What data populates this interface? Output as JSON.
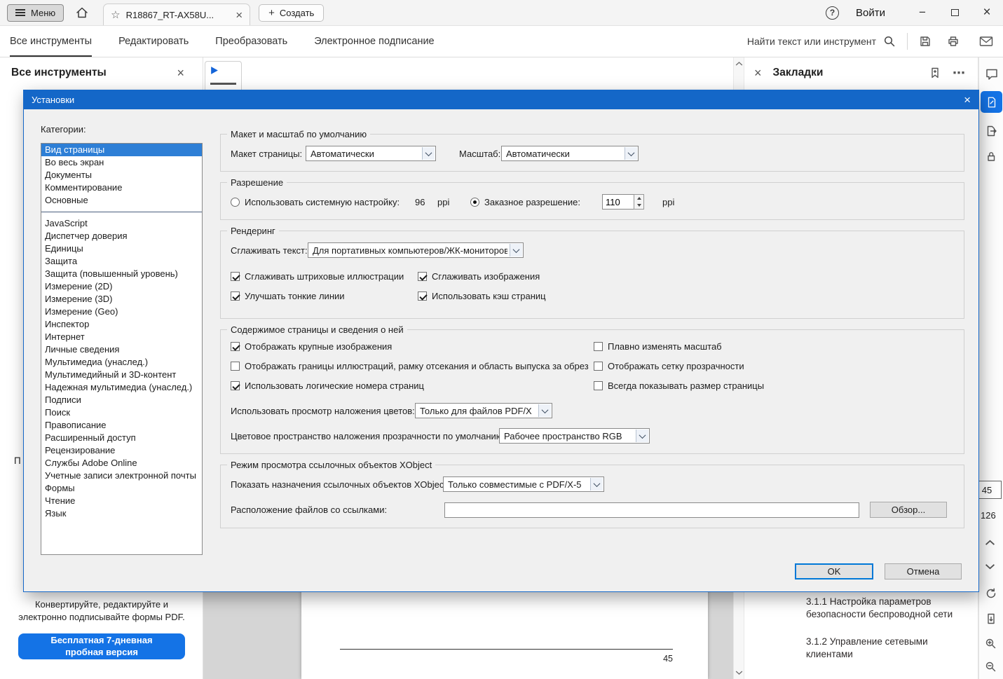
{
  "colors": {
    "accent_blue": "#1473e6",
    "titlebar_blue": "#1467c8",
    "selection_blue": "#2e7fd6",
    "ok_border": "#0078d7"
  },
  "icons": {
    "star": "☆",
    "close": "×",
    "plus": "+",
    "minus": "−",
    "overflow": "⋯",
    "help": "?"
  },
  "window": {
    "menu_label": "Меню",
    "tab_title": "R18867_RT-AX58U...",
    "create_label": "Создать",
    "signin_label": "Войти"
  },
  "toolbar": {
    "tabs": [
      "Все инструменты",
      "Редактировать",
      "Преобразовать",
      "Электронное подписание"
    ],
    "search_label": "Найти текст или инструмент"
  },
  "tools_panel": {
    "title": "Все инструменты",
    "partial_text": "П",
    "promo": "Конвертируйте, редактируйте и электронно подписывайте формы PDF.",
    "trial_line1": "Бесплатная 7-дневная",
    "trial_line2": "пробная версия"
  },
  "bookmarks": {
    "title": "Закладки",
    "items": [
      "3.1.1 Настройка параметров безопасности беспроводной сети",
      "3.1.2 Управление сетевыми клиентами"
    ]
  },
  "page_nav": {
    "current": "45",
    "total": "126"
  },
  "document": {
    "page_label": "45"
  },
  "dialog": {
    "title": "Установки",
    "categories_label": "Категории:",
    "categories_main": [
      "Вид страницы",
      "Во весь экран",
      "Документы",
      "Комментирование",
      "Основные"
    ],
    "categories_rest": [
      "JavaScript",
      "Диспетчер доверия",
      "Единицы",
      "Защита",
      "Защита (повышенный уровень)",
      "Измерение (2D)",
      "Измерение (3D)",
      "Измерение (Geo)",
      "Инспектор",
      "Интернет",
      "Личные сведения",
      "Мультимедиа (унаслед.)",
      "Мультимедийный и 3D-контент",
      "Надежная мультимедиа (унаслед.)",
      "Подписи",
      "Поиск",
      "Правописание",
      "Расширенный доступ",
      "Рецензирование",
      "Службы Adobe Online",
      "Учетные записи электронной почты",
      "Формы",
      "Чтение",
      "Язык"
    ],
    "layout_group": {
      "title": "Макет и масштаб по умолчанию",
      "page_layout_label": "Макет страницы:",
      "page_layout_value": "Автоматически",
      "zoom_label": "Масштаб:",
      "zoom_value": "Автоматически"
    },
    "resolution_group": {
      "title": "Разрешение",
      "system_label": "Использовать системную настройку:",
      "system_checked": false,
      "system_value": "96",
      "ppi": "ppi",
      "custom_label": "Заказное разрешение:",
      "custom_checked": true,
      "custom_value": "110"
    },
    "rendering_group": {
      "title": "Рендеринг",
      "smooth_text_label": "Сглаживать текст:",
      "smooth_text_value": "Для портативных компьютеров/ЖК-мониторов",
      "checks": [
        {
          "label": "Сглаживать штриховые иллюстрации",
          "checked": true
        },
        {
          "label": "Сглаживать изображения",
          "checked": true
        },
        {
          "label": "Улучшать тонкие линии",
          "checked": true
        },
        {
          "label": "Использовать кэш страниц",
          "checked": true
        }
      ]
    },
    "content_group": {
      "title": "Содержимое страницы и сведения о ней",
      "checks_left": [
        {
          "label": "Отображать крупные изображения",
          "checked": true
        },
        {
          "label": "Отображать границы иллюстраций, рамку отсекания и область выпуска за обрез",
          "checked": false
        },
        {
          "label": "Использовать логические номера страниц",
          "checked": true
        }
      ],
      "checks_right": [
        {
          "label": "Плавно изменять масштаб",
          "checked": false
        },
        {
          "label": "Отображать сетку прозрачности",
          "checked": false
        },
        {
          "label": "Всегда показывать размер страницы",
          "checked": false
        }
      ],
      "overprint_label": "Использовать просмотр наложения цветов:",
      "overprint_value": "Только для файлов PDF/X",
      "colorspace_label": "Цветовое пространство наложения прозрачности по умолчанию:",
      "colorspace_value": "Рабочее пространство RGB"
    },
    "xobject_group": {
      "title": "Режим просмотра ссылочных объектов XObject",
      "show_label": "Показать назначения ссылочных объектов XObject:",
      "show_value": "Только совместимые с PDF/X-5",
      "location_label": "Расположение файлов со ссылками:",
      "location_value": "",
      "browse_label": "Обзор..."
    },
    "ok_label": "OK",
    "cancel_label": "Отмена"
  }
}
